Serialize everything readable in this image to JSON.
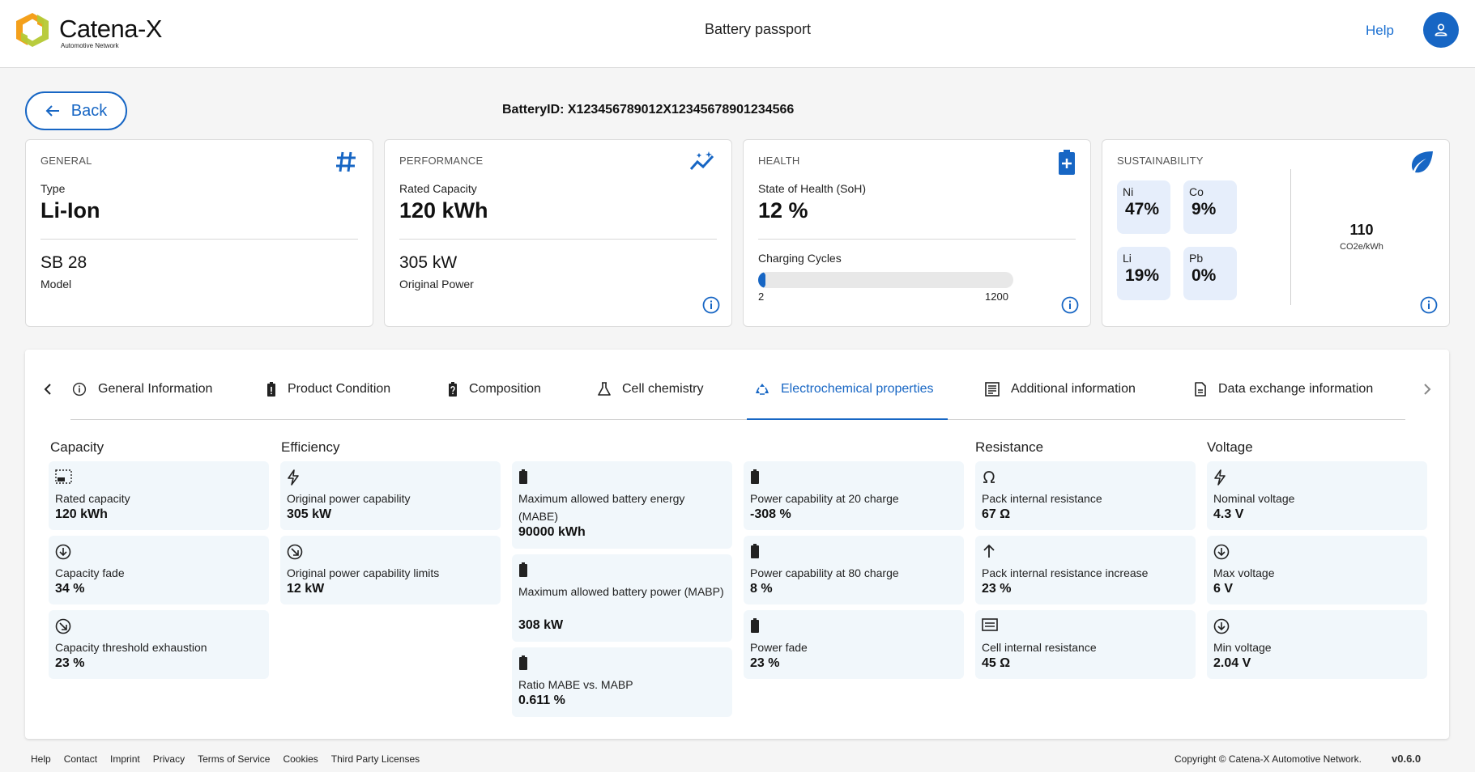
{
  "header": {
    "logo_text": "Catena-X",
    "logo_sub": "Automotive Network",
    "title": "Battery passport",
    "help_label": "Help"
  },
  "toolbar": {
    "back_label": "Back",
    "battery_id": "BatteryID: X123456789012X12345678901234566"
  },
  "cards": {
    "general": {
      "title": "GENERAL",
      "type_label": "Type",
      "type_value": "Li-Ion",
      "model_value": "SB 28",
      "model_label": "Model"
    },
    "performance": {
      "title": "PERFORMANCE",
      "capacity_label": "Rated Capacity",
      "capacity_value": "120 kWh",
      "power_value": "305 kW",
      "power_label": "Original Power"
    },
    "health": {
      "title": "HEALTH",
      "soh_label": "State of Health (SoH)",
      "soh_value": "12 %",
      "cycles_label": "Charging Cycles",
      "cycles_current": "2",
      "cycles_max": "1200",
      "cycles_fraction": 0.0017
    },
    "sustainability": {
      "title": "SUSTAINABILITY",
      "materials": [
        {
          "symbol": "Ni",
          "value": "47%"
        },
        {
          "symbol": "Co",
          "value": "9%"
        },
        {
          "symbol": "Li",
          "value": "19%"
        },
        {
          "symbol": "Pb",
          "value": "0%"
        }
      ],
      "co2_value": "110",
      "co2_unit": "CO2e/kWh"
    }
  },
  "tabs": [
    {
      "label": "General Information",
      "icon": "info-icon"
    },
    {
      "label": "Product Condition",
      "icon": "battery-alert-icon"
    },
    {
      "label": "Composition",
      "icon": "battery-unknown-icon"
    },
    {
      "label": "Cell chemistry",
      "icon": "flask-icon"
    },
    {
      "label": "Electrochemical properties",
      "icon": "recycle-icon",
      "active": true
    },
    {
      "label": "Additional information",
      "icon": "article-icon"
    },
    {
      "label": "Data exchange information",
      "icon": "file-icon"
    }
  ],
  "sections": {
    "capacity": "Capacity",
    "efficiency": "Efficiency",
    "resistance": "Resistance",
    "voltage": "Voltage"
  },
  "properties": {
    "capacity": [
      {
        "label": "Rated capacity",
        "value": "120 kWh",
        "icon": "battery-level-icon"
      },
      {
        "label": "Capacity fade",
        "value": "34 %",
        "icon": "arrow-circle-down-icon"
      },
      {
        "label": "Capacity threshold exhaustion",
        "value": "23 %",
        "icon": "arrow-circle-diagonal-icon"
      }
    ],
    "efficiency": [
      {
        "label": "Original power capability",
        "value": "305 kW",
        "icon": "bolt-icon"
      },
      {
        "label": "Original power capability limits",
        "value": "12 kW",
        "icon": "arrow-circle-diagonal-icon"
      }
    ],
    "energy": [
      {
        "label": "Maximum allowed battery energy (MABE)",
        "value": "90000 kWh",
        "icon": "battery-icon"
      },
      {
        "label": "Maximum allowed battery power (MABP)",
        "value": "308 kW",
        "icon": "battery-icon"
      },
      {
        "label": "Ratio MABE vs. MABP",
        "value": "0.611 %",
        "icon": "battery-icon"
      }
    ],
    "power": [
      {
        "label": "Power capability at 20 charge",
        "value": "-308 %",
        "icon": "battery-icon"
      },
      {
        "label": "Power capability at 80 charge",
        "value": "8 %",
        "icon": "battery-icon"
      },
      {
        "label": "Power fade",
        "value": "23 %",
        "icon": "battery-icon"
      }
    ],
    "resistance": [
      {
        "label": "Pack internal resistance",
        "value": "67 Ω",
        "icon": "omega-icon"
      },
      {
        "label": "Pack internal resistance increase",
        "value": "23 %",
        "icon": "arrow-up-icon"
      },
      {
        "label": "Cell internal resistance",
        "value": "45 Ω",
        "icon": "resistor-icon"
      }
    ],
    "voltage": [
      {
        "label": "Nominal voltage",
        "value": "4.3 V",
        "icon": "bolt-icon"
      },
      {
        "label": "Max voltage",
        "value": "6 V",
        "icon": "arrow-circle-down-icon"
      },
      {
        "label": "Min voltage",
        "value": "2.04 V",
        "icon": "arrow-circle-down-icon"
      }
    ]
  },
  "footer": {
    "links": [
      "Help",
      "Contact",
      "Imprint",
      "Privacy",
      "Terms of Service",
      "Cookies",
      "Third Party Licenses"
    ],
    "copyright": "Copyright © Catena-X Automotive Network.",
    "version": "v0.6.0"
  },
  "colors": {
    "accent": "#1766c4",
    "item_bg": "#f1f7fb",
    "material_bg": "#e6eefb",
    "logo_orange": "#f4a01b",
    "logo_green": "#b5c934"
  }
}
